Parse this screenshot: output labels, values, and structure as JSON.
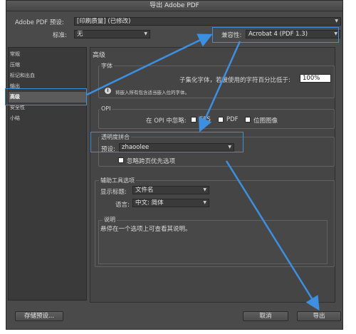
{
  "window": {
    "title": "导出 Adobe PDF"
  },
  "header": {
    "preset_label": "Adobe PDF 预设:",
    "preset_value": "[印刷质量] (已修改)",
    "standard_label": "标准:",
    "standard_value": "无",
    "compat_label": "兼容性:",
    "compat_value": "Acrobat 4 (PDF 1.3)"
  },
  "sidebar": {
    "items": [
      {
        "label": "常规"
      },
      {
        "label": "压缩"
      },
      {
        "label": "标记和出血"
      },
      {
        "label": "输出"
      },
      {
        "label": "高级"
      },
      {
        "label": "安全性"
      },
      {
        "label": "小结"
      }
    ],
    "selected": "高级"
  },
  "main": {
    "section_title": "高级",
    "fonts": {
      "title": "字体",
      "subset_label": "子集化字体，若被使用的字符百分比低于:",
      "subset_value": "100%",
      "note": "将嵌入所有包含适当嵌入位的字体。"
    },
    "opi": {
      "title": "OPI",
      "omit_label": "在 OPI 中忽略:",
      "options": [
        "EPS",
        "PDF",
        "位图图像"
      ]
    },
    "flattener": {
      "title": "透明度拼合",
      "preset_label": "预设:",
      "preset_value": "zhaoolee",
      "ignore_label": "忽略跨页优先选项"
    },
    "accessibility": {
      "title": "辅助工具选项",
      "display_title_label": "显示标题:",
      "display_title_value": "文件名",
      "language_label": "语言:",
      "language_value": "中文: 简体"
    },
    "description": {
      "title": "说明",
      "text": "悬停在一个选项上可查看其说明。"
    }
  },
  "footer": {
    "save_preset": "存储预设...",
    "cancel": "取消",
    "export": "导出"
  },
  "colors": {
    "annotation": "#3d8fe0",
    "window_bg": "#4a4a4a"
  }
}
